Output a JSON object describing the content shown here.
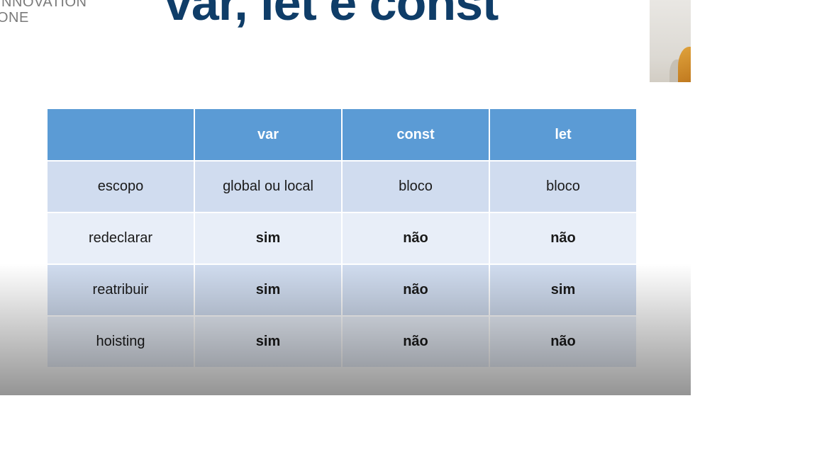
{
  "logo": {
    "line1": "INNOVATION",
    "line2": "ONE"
  },
  "slide": {
    "title": "var, let e const"
  },
  "table": {
    "headers": [
      "",
      "var",
      "const",
      "let"
    ],
    "rows": [
      {
        "label": "escopo",
        "var": "global ou local",
        "const": "bloco",
        "let": "bloco"
      },
      {
        "label": "redeclarar",
        "var": "sim",
        "const": "não",
        "let": "não"
      },
      {
        "label": "reatribuir",
        "var": "sim",
        "const": "não",
        "let": "sim"
      },
      {
        "label": "hoisting",
        "var": "sim",
        "const": "não",
        "let": "não"
      }
    ]
  },
  "colors": {
    "title": "#0f3d68",
    "header_bg": "#5b9bd5",
    "yes": "#1e9c52",
    "no": "#d00000"
  },
  "icons": {
    "webcam": "presenter-webcam"
  }
}
